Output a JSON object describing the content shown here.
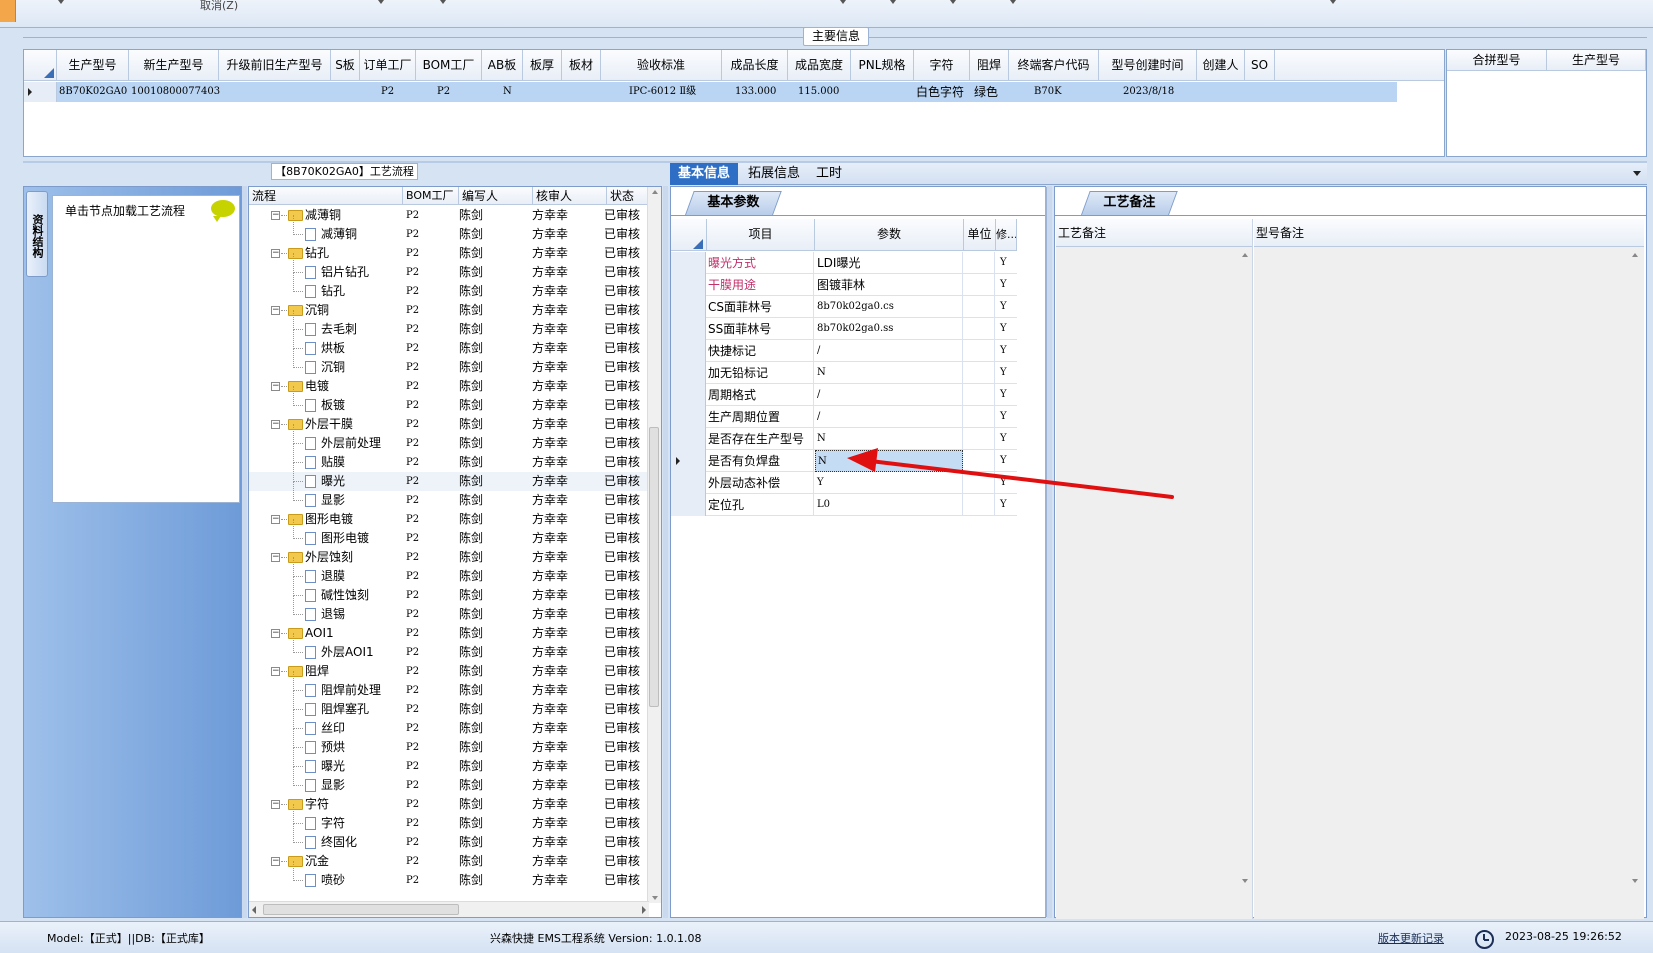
{
  "top": {
    "cancel_label": "取消(Z)"
  },
  "main_info": {
    "title": "主要信息",
    "columns": [
      "生产型号",
      "新生产型号",
      "升级前旧生产型号",
      "S板",
      "订单工厂",
      "BOM工厂",
      "AB板",
      "板厚",
      "板材",
      "验收标准",
      "成品长度",
      "成品宽度",
      "PNL规格",
      "字符",
      "阻焊",
      "终端客户代码",
      "型号创建时间",
      "创建人",
      "SO"
    ],
    "row": [
      "8B70K02GA0",
      "10010800077403",
      "",
      "",
      "P2",
      "P2",
      "N",
      "",
      "",
      "IPC-6012 Ⅱ级",
      "133.000",
      "115.000",
      "",
      "白色字符",
      "绿色",
      "B70K",
      "2023/8/18",
      "",
      ""
    ],
    "merge_columns": [
      "合拼型号",
      "生产型号"
    ]
  },
  "left_panel": {
    "vertical_tab": "资料结构",
    "hint": "单击节点加载工艺流程"
  },
  "process_flow": {
    "title": "【8B70K02GA0】工艺流程",
    "columns": [
      "流程",
      "BOM工厂",
      "编写人",
      "核审人",
      "状态"
    ],
    "rows": [
      {
        "name": "减薄铜",
        "bom": "P2",
        "writer": "陈剑",
        "reviewer": "方幸幸",
        "status": "已审核",
        "level": 1
      },
      {
        "name": "减薄铜",
        "bom": "P2",
        "writer": "陈剑",
        "reviewer": "方幸幸",
        "status": "已审核",
        "level": 2
      },
      {
        "name": "钻孔",
        "bom": "P2",
        "writer": "陈剑",
        "reviewer": "方幸幸",
        "status": "已审核",
        "level": 1
      },
      {
        "name": "铝片钻孔",
        "bom": "P2",
        "writer": "陈剑",
        "reviewer": "方幸幸",
        "status": "已审核",
        "level": 2
      },
      {
        "name": "钻孔",
        "bom": "P2",
        "writer": "陈剑",
        "reviewer": "方幸幸",
        "status": "已审核",
        "level": 2
      },
      {
        "name": "沉铜",
        "bom": "P2",
        "writer": "陈剑",
        "reviewer": "方幸幸",
        "status": "已审核",
        "level": 1
      },
      {
        "name": "去毛刺",
        "bom": "P2",
        "writer": "陈剑",
        "reviewer": "方幸幸",
        "status": "已审核",
        "level": 2
      },
      {
        "name": "烘板",
        "bom": "P2",
        "writer": "陈剑",
        "reviewer": "方幸幸",
        "status": "已审核",
        "level": 2
      },
      {
        "name": "沉铜",
        "bom": "P2",
        "writer": "陈剑",
        "reviewer": "方幸幸",
        "status": "已审核",
        "level": 2
      },
      {
        "name": "电镀",
        "bom": "P2",
        "writer": "陈剑",
        "reviewer": "方幸幸",
        "status": "已审核",
        "level": 1
      },
      {
        "name": "板镀",
        "bom": "P2",
        "writer": "陈剑",
        "reviewer": "方幸幸",
        "status": "已审核",
        "level": 2
      },
      {
        "name": "外层干膜",
        "bom": "P2",
        "writer": "陈剑",
        "reviewer": "方幸幸",
        "status": "已审核",
        "level": 1
      },
      {
        "name": "外层前处理",
        "bom": "P2",
        "writer": "陈剑",
        "reviewer": "方幸幸",
        "status": "已审核",
        "level": 2
      },
      {
        "name": "贴膜",
        "bom": "P2",
        "writer": "陈剑",
        "reviewer": "方幸幸",
        "status": "已审核",
        "level": 2
      },
      {
        "name": "曝光",
        "bom": "P2",
        "writer": "陈剑",
        "reviewer": "方幸幸",
        "status": "已审核",
        "level": 2,
        "selected": true
      },
      {
        "name": "显影",
        "bom": "P2",
        "writer": "陈剑",
        "reviewer": "方幸幸",
        "status": "已审核",
        "level": 2
      },
      {
        "name": "图形电镀",
        "bom": "P2",
        "writer": "陈剑",
        "reviewer": "方幸幸",
        "status": "已审核",
        "level": 1
      },
      {
        "name": "图形电镀",
        "bom": "P2",
        "writer": "陈剑",
        "reviewer": "方幸幸",
        "status": "已审核",
        "level": 2
      },
      {
        "name": "外层蚀刻",
        "bom": "P2",
        "writer": "陈剑",
        "reviewer": "方幸幸",
        "status": "已审核",
        "level": 1
      },
      {
        "name": "退膜",
        "bom": "P2",
        "writer": "陈剑",
        "reviewer": "方幸幸",
        "status": "已审核",
        "level": 2
      },
      {
        "name": "碱性蚀刻",
        "bom": "P2",
        "writer": "陈剑",
        "reviewer": "方幸幸",
        "status": "已审核",
        "level": 2
      },
      {
        "name": "退锡",
        "bom": "P2",
        "writer": "陈剑",
        "reviewer": "方幸幸",
        "status": "已审核",
        "level": 2
      },
      {
        "name": "AOI1",
        "bom": "P2",
        "writer": "陈剑",
        "reviewer": "方幸幸",
        "status": "已审核",
        "level": 1
      },
      {
        "name": "外层AOI1",
        "bom": "P2",
        "writer": "陈剑",
        "reviewer": "方幸幸",
        "status": "已审核",
        "level": 2
      },
      {
        "name": "阻焊",
        "bom": "P2",
        "writer": "陈剑",
        "reviewer": "方幸幸",
        "status": "已审核",
        "level": 1
      },
      {
        "name": "阻焊前处理",
        "bom": "P2",
        "writer": "陈剑",
        "reviewer": "方幸幸",
        "status": "已审核",
        "level": 2
      },
      {
        "name": "阻焊塞孔",
        "bom": "P2",
        "writer": "陈剑",
        "reviewer": "方幸幸",
        "status": "已审核",
        "level": 2
      },
      {
        "name": "丝印",
        "bom": "P2",
        "writer": "陈剑",
        "reviewer": "方幸幸",
        "status": "已审核",
        "level": 2
      },
      {
        "name": "预烘",
        "bom": "P2",
        "writer": "陈剑",
        "reviewer": "方幸幸",
        "status": "已审核",
        "level": 2
      },
      {
        "name": "曝光",
        "bom": "P2",
        "writer": "陈剑",
        "reviewer": "方幸幸",
        "status": "已审核",
        "level": 2
      },
      {
        "name": "显影",
        "bom": "P2",
        "writer": "陈剑",
        "reviewer": "方幸幸",
        "status": "已审核",
        "level": 2
      },
      {
        "name": "字符",
        "bom": "P2",
        "writer": "陈剑",
        "reviewer": "方幸幸",
        "status": "已审核",
        "level": 1
      },
      {
        "name": "字符",
        "bom": "P2",
        "writer": "陈剑",
        "reviewer": "方幸幸",
        "status": "已审核",
        "level": 2
      },
      {
        "name": "终固化",
        "bom": "P2",
        "writer": "陈剑",
        "reviewer": "方幸幸",
        "status": "已审核",
        "level": 2
      },
      {
        "name": "沉金",
        "bom": "P2",
        "writer": "陈剑",
        "reviewer": "方幸幸",
        "status": "已审核",
        "level": 1
      },
      {
        "name": "喷砂",
        "bom": "P2",
        "writer": "陈剑",
        "reviewer": "方幸幸",
        "status": "已审核",
        "level": 2
      }
    ]
  },
  "tabs": [
    "基本信息",
    "拓展信息",
    "工时"
  ],
  "basic_params": {
    "group_title": "基本参数",
    "columns": [
      "项目",
      "参数",
      "单位",
      "修..."
    ],
    "rows": [
      {
        "item": "曝光方式",
        "param": "LDI曝光",
        "unit": "",
        "mod": "Y",
        "highlight": true
      },
      {
        "item": "干膜用途",
        "param": "图镀菲林",
        "unit": "",
        "mod": "Y",
        "highlight": true
      },
      {
        "item": "CS面菲林号",
        "param": "8b70k02ga0.cs",
        "unit": "",
        "mod": "Y"
      },
      {
        "item": "SS面菲林号",
        "param": "8b70k02ga0.ss",
        "unit": "",
        "mod": "Y"
      },
      {
        "item": "快捷标记",
        "param": "/",
        "unit": "",
        "mod": "Y"
      },
      {
        "item": "加无铅标记",
        "param": "N",
        "unit": "",
        "mod": "Y"
      },
      {
        "item": "周期格式",
        "param": "/",
        "unit": "",
        "mod": "Y"
      },
      {
        "item": "生产周期位置",
        "param": "/",
        "unit": "",
        "mod": "Y"
      },
      {
        "item": "是否存在生产型号",
        "param": "N",
        "unit": "",
        "mod": "Y"
      },
      {
        "item": "是否有负焊盘",
        "param": "N",
        "unit": "",
        "mod": "Y",
        "selected": true
      },
      {
        "item": "外层动态补偿",
        "param": "Y",
        "unit": "",
        "mod": "Y"
      },
      {
        "item": "定位孔",
        "param": "L0",
        "unit": "",
        "mod": "Y"
      }
    ]
  },
  "process_notes": {
    "group_title": "工艺备注",
    "columns": [
      "工艺备注",
      "型号备注"
    ]
  },
  "status_bar": {
    "model": "Model:【正式】||DB:【正式库】",
    "system": "兴森快捷 EMS工程系统 Version: 1.0.1.08",
    "update_link": "版本更新记录",
    "datetime": "2023-08-25 19:26:52"
  },
  "colors": {
    "accent": "#2e6ec5",
    "selection": "#b9d5f3",
    "highlight_text": "#c0306a",
    "annotation_arrow": "#e01010"
  }
}
